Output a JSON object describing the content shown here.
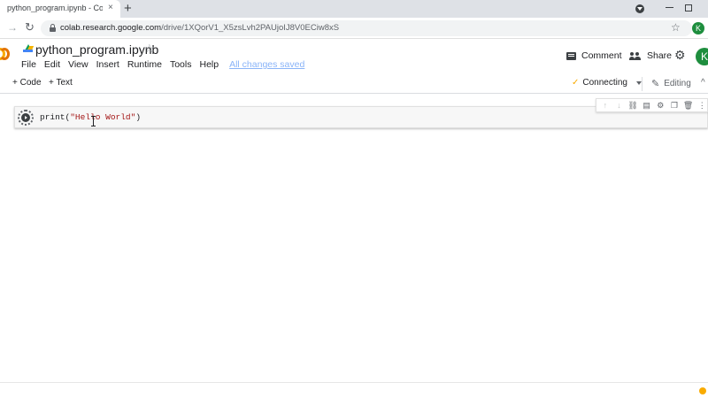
{
  "browser": {
    "tab_title": "python_program.ipynb - Colabora",
    "tab_close_glyph": "×",
    "new_tab_glyph": "+",
    "url_host": "colab.research.google.com",
    "url_path": "/drive/1XQorV1_X5zsLvh2PAUjoIJ8V0ECiw8xS",
    "profile_initial": "K",
    "icons": [
      "forward-arrow-icon",
      "reload-icon",
      "lock-icon",
      "bookmark-star-icon",
      "tab-search-icon",
      "minimize-icon",
      "restore-icon"
    ]
  },
  "header": {
    "notebook_title": "python_program.ipynb",
    "menu": [
      "File",
      "Edit",
      "View",
      "Insert",
      "Runtime",
      "Tools",
      "Help"
    ],
    "saved_status": "All changes saved",
    "comment_label": "Comment",
    "share_label": "Share",
    "avatar_initial": "K"
  },
  "toolbar": {
    "add_code": "+ Code",
    "add_text": "+ Text",
    "connect_status": "Connecting",
    "editing_label": "Editing"
  },
  "cell": {
    "code_fn": "print(",
    "code_str": "\"Hello World\"",
    "code_close": ")",
    "toolbar_icons": [
      "move-up-icon",
      "move-down-icon",
      "link-icon",
      "comment-icon",
      "settings-icon",
      "mirror-icon",
      "delete-icon",
      "more-icon"
    ]
  },
  "colors": {
    "accent_green": "#1e8e3e",
    "colab_orange": "#f9ab00",
    "saved_link": "#8ab4f8"
  }
}
